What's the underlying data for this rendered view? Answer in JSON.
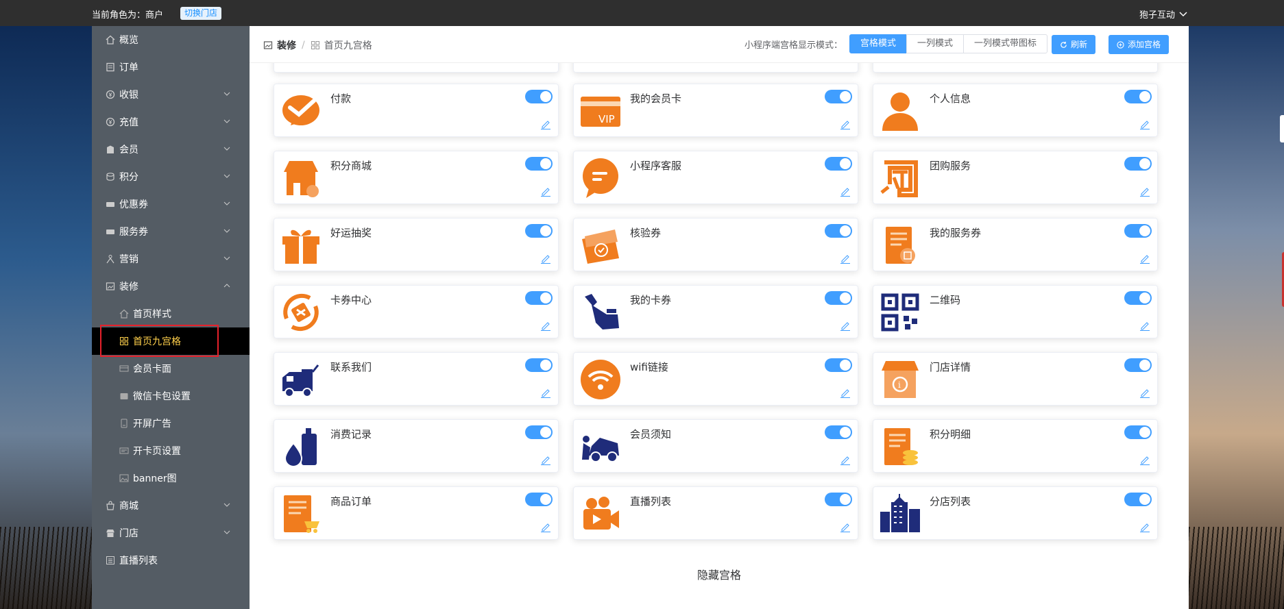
{
  "topbar": {
    "role_text": "当前角色为：商户",
    "switch_label": "切换门店",
    "user_name": "狍子互动"
  },
  "sidebar": {
    "items": [
      {
        "label": "概览",
        "icon": "home-icon",
        "expandable": false
      },
      {
        "label": "订单",
        "icon": "order-icon",
        "expandable": false
      },
      {
        "label": "收银",
        "icon": "cashier-icon",
        "expandable": true
      },
      {
        "label": "充值",
        "icon": "recharge-icon",
        "expandable": true
      },
      {
        "label": "会员",
        "icon": "member-icon",
        "expandable": true
      },
      {
        "label": "积分",
        "icon": "points-icon",
        "expandable": true
      },
      {
        "label": "优惠券",
        "icon": "coupon-icon",
        "expandable": true
      },
      {
        "label": "服务券",
        "icon": "service-coupon-icon",
        "expandable": true
      },
      {
        "label": "营销",
        "icon": "marketing-icon",
        "expandable": true
      },
      {
        "label": "装修",
        "icon": "decorate-icon",
        "expandable": true,
        "expanded": true
      }
    ],
    "sub_items": [
      {
        "label": "首页样式",
        "icon": "home-outline-icon"
      },
      {
        "label": "首页九宫格",
        "icon": "grid-icon",
        "active": true
      },
      {
        "label": "会员卡面",
        "icon": "card-icon"
      },
      {
        "label": "微信卡包设置",
        "icon": "wallet-icon"
      },
      {
        "label": "开屏广告",
        "icon": "phone-icon"
      },
      {
        "label": "开卡页设置",
        "icon": "card-settings-icon"
      },
      {
        "label": "banner图",
        "icon": "image-icon"
      }
    ],
    "bottom_items": [
      {
        "label": "商城",
        "icon": "mall-icon",
        "expandable": true
      },
      {
        "label": "门店",
        "icon": "store-icon",
        "expandable": true
      },
      {
        "label": "直播列表",
        "icon": "live-list-icon",
        "expandable": false
      }
    ]
  },
  "header": {
    "breadcrumb": [
      "装修",
      "首页九宫格"
    ],
    "mode_label": "小程序端宫格显示模式：",
    "modes": [
      "宫格模式",
      "一列模式",
      "一列模式带图标"
    ],
    "selected_mode": "宫格模式",
    "refresh_label": "刷新",
    "add_label": "添加宫格"
  },
  "grid": {
    "items": [
      {
        "title": "付款",
        "icon": "payment-icon",
        "enabled": true
      },
      {
        "title": "我的会员卡",
        "icon": "vip-card-icon",
        "enabled": true
      },
      {
        "title": "个人信息",
        "icon": "person-icon",
        "enabled": true
      },
      {
        "title": "积分商城",
        "icon": "points-mall-icon",
        "enabled": true
      },
      {
        "title": "小程序客服",
        "icon": "chat-bubble-icon",
        "enabled": true
      },
      {
        "title": "团购服务",
        "icon": "group-buy-icon",
        "enabled": true
      },
      {
        "title": "好运抽奖",
        "icon": "gift-icon",
        "enabled": true
      },
      {
        "title": "核验券",
        "icon": "ticket-check-icon",
        "enabled": true
      },
      {
        "title": "我的服务券",
        "icon": "service-doc-icon",
        "enabled": true
      },
      {
        "title": "卡券中心",
        "icon": "coupon-center-icon",
        "enabled": true
      },
      {
        "title": "我的卡券",
        "icon": "hand-tool-icon",
        "enabled": true
      },
      {
        "title": "二维码",
        "icon": "qrcode-icon",
        "enabled": true
      },
      {
        "title": "联系我们",
        "icon": "truck-icon",
        "enabled": true
      },
      {
        "title": "wifi链接",
        "icon": "wifi-icon",
        "enabled": true
      },
      {
        "title": "门店详情",
        "icon": "shop-info-icon",
        "enabled": true
      },
      {
        "title": "消费记录",
        "icon": "oil-drop-icon",
        "enabled": true
      },
      {
        "title": "会员须知",
        "icon": "car-repair-icon",
        "enabled": true
      },
      {
        "title": "积分明细",
        "icon": "points-detail-icon",
        "enabled": true
      },
      {
        "title": "商品订单",
        "icon": "goods-order-icon",
        "enabled": true
      },
      {
        "title": "直播列表",
        "icon": "live-camera-icon",
        "enabled": true
      },
      {
        "title": "分店列表",
        "icon": "city-buildings-icon",
        "enabled": true
      }
    ]
  },
  "hidden_section_title": "隐藏宫格",
  "colors": {
    "accent": "#409eff",
    "sidebar_bg": "#545c64",
    "active_text": "#ffd04b",
    "highlight_border": "#e6212b",
    "icon_orange": "#f07c1e",
    "icon_navy": "#1f2c7a"
  }
}
